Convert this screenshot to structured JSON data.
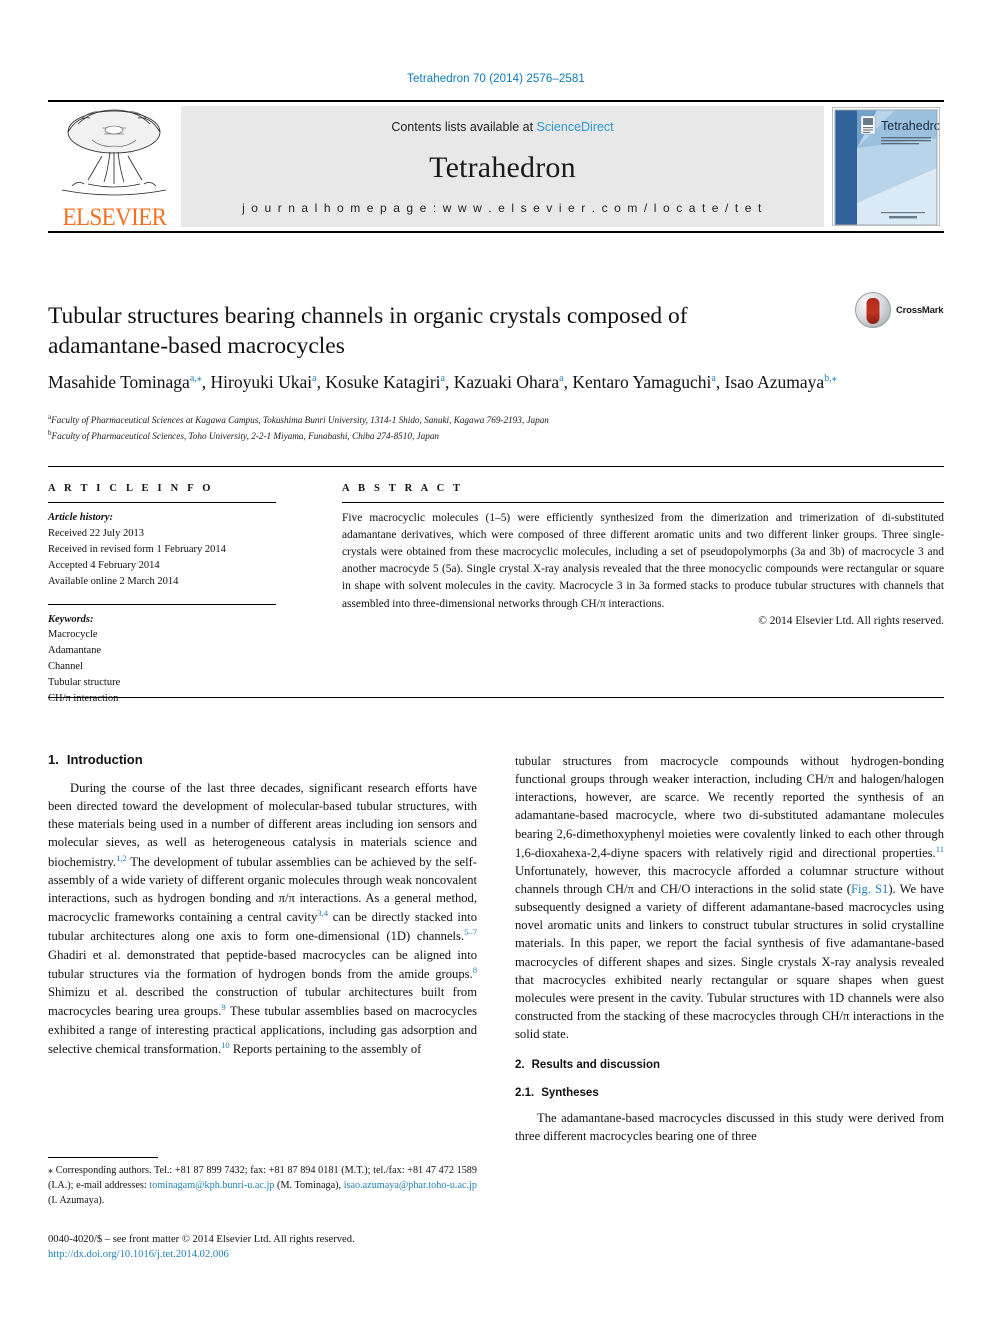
{
  "running_head": "Tetrahedron 70 (2014) 2576–2581",
  "masthead": {
    "publisher_name": "ELSEVIER",
    "contents_prefix": "Contents lists available at ",
    "contents_link": "ScienceDirect",
    "journal_name": "Tetrahedron",
    "homepage_line": "j o u r n a l   h o m e p a g e :   w w w . e l s e v i e r . c o m / l o c a t e / t e t",
    "cover_title": "Tetrahedron",
    "cover_subtitle": "An International Journal for the Rapid Publication of Full Original Research Papers and Critical Reviews in Organic Chemistry",
    "cover_footer": "ELSEVIER"
  },
  "article": {
    "title": "Tubular structures bearing channels in organic crystals composed of adamantane-based macrocycles",
    "crossmark_label": "CrossMark",
    "authors_line_1": "Masahide Tominaga",
    "authors_html": "Masahide Tominaga<sup>a,⁎</sup>, Hiroyuki Ukai<sup>a</sup>, Kosuke Katagiri<sup>a</sup>, Kazuaki Ohara<sup>a</sup>, Kentaro Yamaguchi<sup>a</sup>, Isao Azumaya<sup>b,⁎</sup>",
    "affiliation_a": "Faculty of Pharmaceutical Sciences at Kagawa Campus, Tokushima Bunri University, 1314-1 Shido, Sanuki, Kagawa 769-2193, Japan",
    "affiliation_b": "Faculty of Pharmaceutical Sciences, Toho University, 2-2-1 Miyama, Funabashi, Chiba 274-8510, Japan",
    "affiliation_a_marker": "a",
    "affiliation_b_marker": "b"
  },
  "article_info": {
    "heading": "A R T I C L E   I N F O",
    "history_label": "Article history:",
    "history": [
      "Received 22 July 2013",
      "Received in revised form 1 February 2014",
      "Accepted 4 February 2014",
      "Available online 2 March 2014"
    ],
    "keywords_label": "Keywords:",
    "keywords": [
      "Macrocycle",
      "Adamantane",
      "Channel",
      "Tubular structure",
      "CH/π interaction"
    ]
  },
  "abstract": {
    "heading": "A B S T R A C T",
    "text": "Five macrocyclic molecules (1–5) were efficiently synthesized from the dimerization and trimerization of di-substituted adamantane derivatives, which were composed of three different aromatic units and two different linker groups. Three single-crystals were obtained from these macrocyclic molecules, including a set of pseudopolymorphs (3a and 3b) of macrocycle 3 and another macrocyde 5 (5a). Single crystal X-ray analysis revealed that the three monocyclic compounds were rectangular or square in shape with solvent molecules in the cavity. Macrocycle 3 in 3a formed stacks to produce tubular structures with channels that assembled into three-dimensional networks through CH/π interactions.",
    "copyright": "© 2014 Elsevier Ltd. All rights reserved."
  },
  "body": {
    "intro_heading_num": "1.",
    "intro_heading": "Introduction",
    "intro_para_html": "During the course of the last three decades, significant research efforts have been directed toward the development of molecular-based tubular structures, with these materials being used in a number of different areas including ion sensors and molecular sieves, as well as heterogeneous catalysis in materials science and biochemistry.<sup>1,2</sup> The development of tubular assemblies can be achieved by the self-assembly of a wide variety of different organic molecules through weak noncovalent interactions, such as hydrogen bonding and π/π interactions. As a general method, macrocyclic frameworks containing a central cavity<sup>3,4</sup> can be directly stacked into tubular architectures along one axis to form one-dimensional (1D) channels.<sup>5–7</sup> Ghadiri et al. demonstrated that peptide-based macrocycles can be aligned into tubular structures via the formation of hydrogen bonds from the amide groups.<sup>8</sup> Shimizu et al. described the construction of tubular architectures built from macrocycles bearing urea groups.<sup>9</sup> These tubular assemblies based on macrocycles exhibited a range of interesting practical applications, including gas adsorption and selective chemical transformation.<sup>10</sup> Reports pertaining to the assembly of",
    "intro_para_cont_html": "tubular structures from macrocycle compounds without hydrogen-bonding functional groups through weaker interaction, including CH/π and halogen/halogen interactions, however, are scarce. We recently reported the synthesis of an adamantane-based macrocycle, where two di-substituted adamantane molecules bearing 2,6-dimethoxyphenyl moieties were covalently linked to each other through 1,6-dioxahexa-2,4-diyne spacers with relatively rigid and directional properties.<sup>11</sup> Unfortunately, however, this macrocycle afforded a columnar structure without channels through CH/π and CH/O interactions in the solid state (<span class=\"lk\">Fig. S1</span>). We have subsequently designed a variety of different adamantane-based macrocycles using novel aromatic units and linkers to construct tubular structures in solid crystalline materials. In this paper, we report the facial synthesis of five adamantane-based macrocycles of different shapes and sizes. Single crystals X-ray analysis revealed that macrocycles exhibited nearly rectangular or square shapes when guest molecules were present in the cavity. Tubular structures with 1D channels were also constructed from the stacking of these macrocycles through CH/π interactions in the solid state.",
    "results_heading_num": "2.",
    "results_heading": "Results and discussion",
    "syntheses_heading_num": "2.1.",
    "syntheses_heading": "Syntheses",
    "syntheses_para": "The adamantane-based macrocycles discussed in this study were derived from three different macrocycles bearing one of three"
  },
  "footnote": {
    "text_html": "⁎ Corresponding authors. Tel.: +81 87 899 7432; fax: +81 87 894 0181 (M.T.); tel./fax: +81 47 472 1589 (I.A.); e-mail addresses: <span class=\"lk\">tominagam@kph.bunri-u.ac.jp</span> (M. Tominaga), <span class=\"lk\">isao.azumaya@phar.toho-u.ac.jp</span> (I. Azumaya).",
    "email_1": "tominagam@kph.bunri-u.ac.jp",
    "email_2": "isao.azumaya@phar.toho-u.ac.jp"
  },
  "imprint": {
    "line": "0040-4020/$ – see front matter © 2014 Elsevier Ltd. All rights reserved.",
    "doi": "http://dx.doi.org/10.1016/j.tet.2014.02.006"
  },
  "colors": {
    "link_blue": "#1f7fb5",
    "sciencedirect_blue": "#2e97d4",
    "elsevier_orange": "#f37021",
    "band_gray": "#e8e8e8"
  }
}
